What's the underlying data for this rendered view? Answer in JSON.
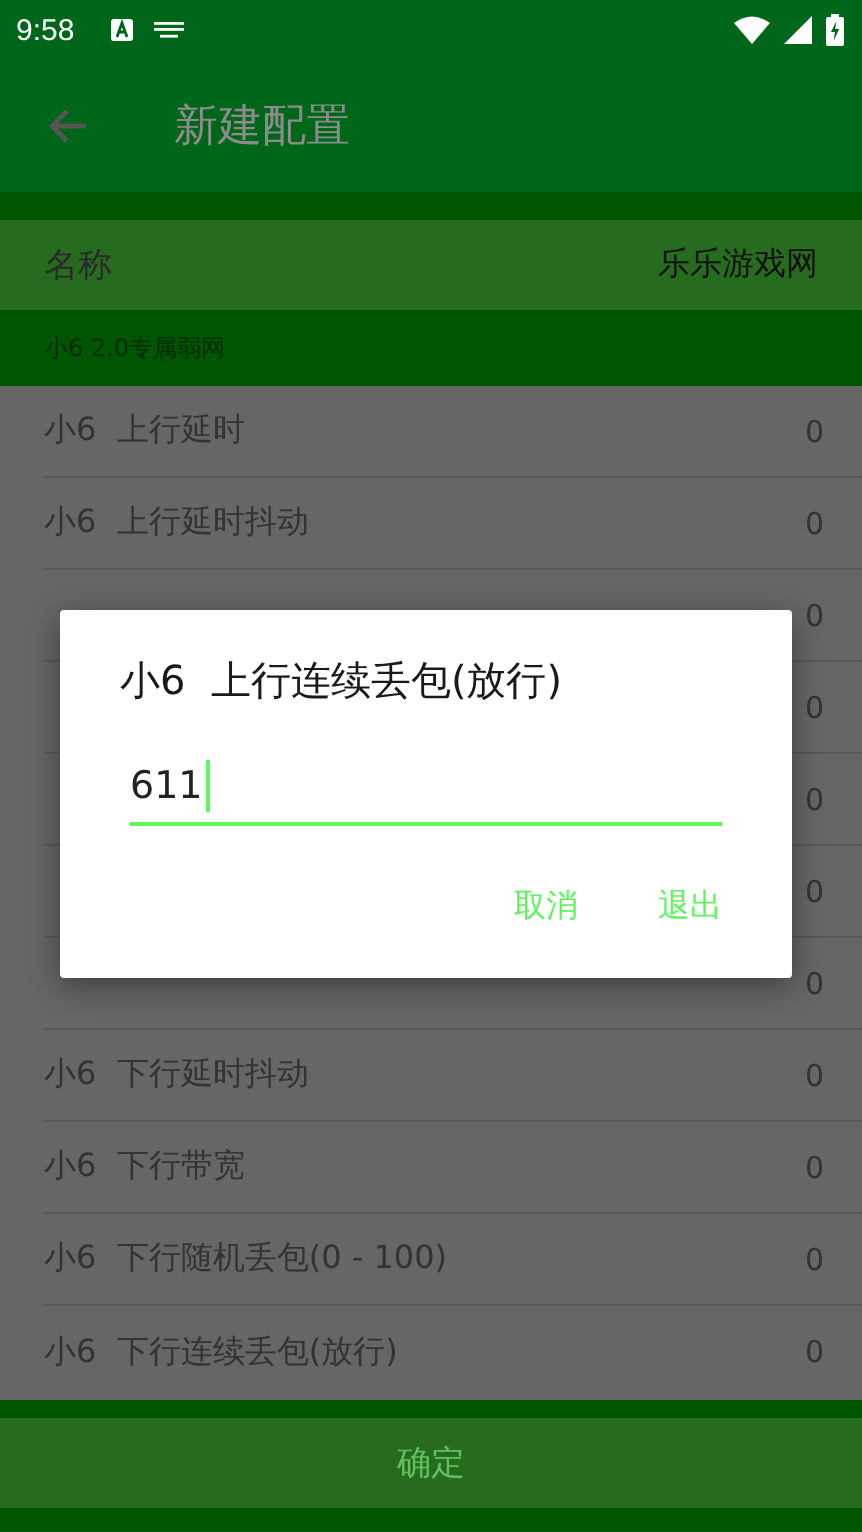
{
  "status_bar": {
    "time": "9:58"
  },
  "app_bar": {
    "title": "新建配置"
  },
  "name_row": {
    "label": "名称",
    "value": "乐乐游戏网"
  },
  "section_header": "小6 2.0专属弱网",
  "rows": [
    {
      "label": "小6  上行延时",
      "value": "0"
    },
    {
      "label": "小6  上行延时抖动",
      "value": "0"
    },
    {
      "value": "0"
    },
    {
      "value": "0"
    },
    {
      "value": "0"
    },
    {
      "value": "0"
    },
    {
      "value": "0"
    },
    {
      "label": "小6  下行延时抖动",
      "value": "0"
    },
    {
      "label": "小6  下行带宽",
      "value": "0"
    },
    {
      "label": "小6  下行随机丢包(0 - 100)",
      "value": "0"
    },
    {
      "label": "小6  下行连续丢包(放行)",
      "value": "0"
    }
  ],
  "confirm_button": "确定",
  "dialog": {
    "title": "小6  上行连续丢包(放行)",
    "value": "611",
    "buttons": [
      "取消",
      "退出"
    ]
  }
}
